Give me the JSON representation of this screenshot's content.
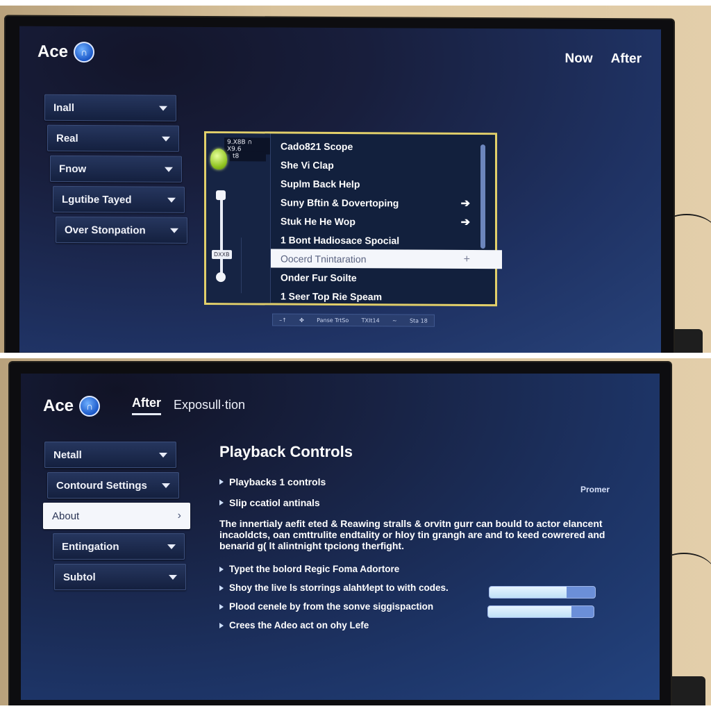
{
  "top": {
    "logo": {
      "text": "Ace",
      "badge": "∩"
    },
    "top_links": [
      "Now",
      "After"
    ],
    "menu": [
      {
        "label": "Inall"
      },
      {
        "label": "Real"
      },
      {
        "label": "Fnow"
      },
      {
        "label": "Lgutibe Tayed"
      },
      {
        "label": "Over Stonpation"
      }
    ],
    "popup": {
      "side": {
        "row1": "9.X8B ∩ X9.6",
        "row2": "t8",
        "slider_label": "DXXB"
      },
      "items": [
        {
          "label": "Cado821 Scope",
          "arrow": ""
        },
        {
          "label": "She Vi Clap",
          "arrow": ""
        },
        {
          "label": "Suplm Back Help",
          "arrow": ""
        },
        {
          "label": "Suny Bftin & Dovertoping",
          "arrow": "➔"
        },
        {
          "label": "Stuk He He Wop",
          "arrow": "➔"
        },
        {
          "label": "1 Bont Hadiosace Spocial",
          "arrow": ""
        },
        {
          "label": "Oocerd Tnintaration",
          "arrow": "+",
          "selected": true
        },
        {
          "label": "Onder Fur Soilte",
          "arrow": ""
        },
        {
          "label": "1 Seer Top Rie Speam",
          "arrow": ""
        }
      ]
    },
    "status_bar": [
      "–↑",
      "✤",
      "Panse TrtSo",
      "TXIt14",
      "∼",
      "Sta 18"
    ]
  },
  "bottom": {
    "logo": {
      "text": "Ace",
      "badge": "∩"
    },
    "tabs": [
      {
        "label": "After",
        "active": true
      },
      {
        "label": "Exposull·tion",
        "active": false
      }
    ],
    "menu": [
      {
        "label": "Netall",
        "active": false
      },
      {
        "label": "Contourd Settings",
        "active": false
      },
      {
        "label": "About",
        "active": true
      },
      {
        "label": "Entingation",
        "active": false
      },
      {
        "label": "Subtol",
        "active": false
      }
    ],
    "content": {
      "title": "Playback Controls",
      "right_label": "Promer",
      "bullets": [
        "Playbacks 1 controls",
        "Slip ccatiol antinals"
      ],
      "paragraph": "The innertialy aefit eted & Reawing stralls & orvitn gurr can bould to actor elancent incaoldcts, oan cmttrulite endtality or hloy tin grangh are and to keed cowrered and benarid g( lt alintnight tpciong therfight.",
      "bullets2": [
        "Typet the bolord Regic Foma Adortore",
        "Shoy the live ls storrings alaht⁄lept to with codes.",
        "Plood cenele by from the sonve siggispaction",
        "Crees the Adeo act on ohy Lefe"
      ],
      "sliders": [
        {
          "value_percent": 73
        },
        {
          "value_percent": 79
        }
      ]
    }
  }
}
